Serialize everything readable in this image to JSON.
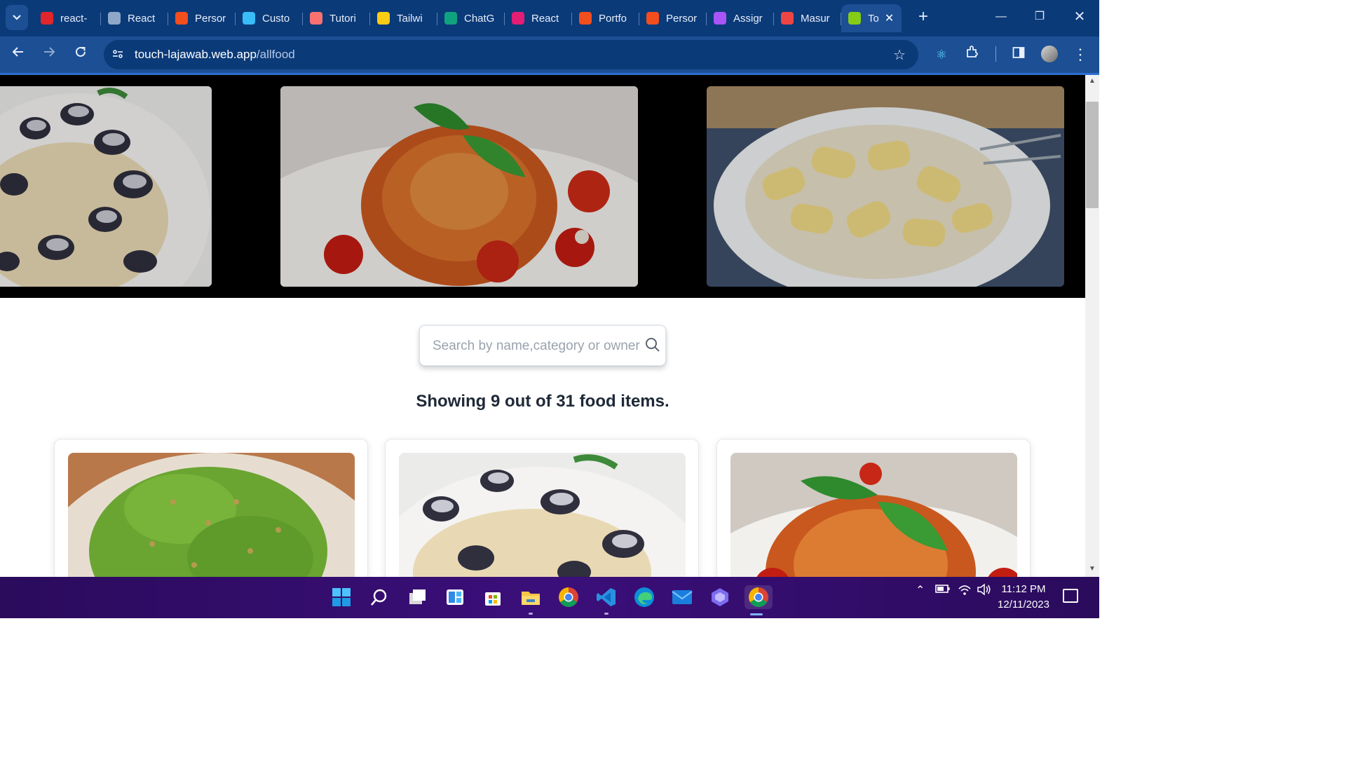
{
  "browser": {
    "tabs": [
      {
        "title": "react-",
        "icon": "netlify-icon",
        "color": "#e0262b"
      },
      {
        "title": "React",
        "icon": "globe-icon",
        "color": "#8fa7c9"
      },
      {
        "title": "Persor",
        "icon": "figma-icon",
        "color": "#f24e1e"
      },
      {
        "title": "Custo",
        "icon": "tailwind-icon",
        "color": "#38bdf8"
      },
      {
        "title": "Tutori",
        "icon": "dots-icon",
        "color": "#f87171"
      },
      {
        "title": "Tailwi",
        "icon": "person-icon",
        "color": "#facc15"
      },
      {
        "title": "ChatG",
        "icon": "chatgpt-icon",
        "color": "#10a37f"
      },
      {
        "title": "React",
        "icon": "react-icon",
        "color": "#e11d74"
      },
      {
        "title": "Portfo",
        "icon": "figma-icon",
        "color": "#f24e1e"
      },
      {
        "title": "Persor",
        "icon": "figma-icon",
        "color": "#f24e1e"
      },
      {
        "title": "Assigr",
        "icon": "assign-icon",
        "color": "#a855f7"
      },
      {
        "title": "Masur",
        "icon": "mascot-icon",
        "color": "#ef4444"
      },
      {
        "title": "To",
        "icon": "lajawab-icon",
        "color": "#84cc16",
        "active": true
      }
    ],
    "url_host": "touch-lajawab.web.app",
    "url_path": "/allfood"
  },
  "page": {
    "search_placeholder": "Search by name,category or owner",
    "showing_text": "Showing 9 out of 31 food items."
  },
  "taskbar": {
    "time": "11:12 PM",
    "date": "12/11/2023"
  }
}
